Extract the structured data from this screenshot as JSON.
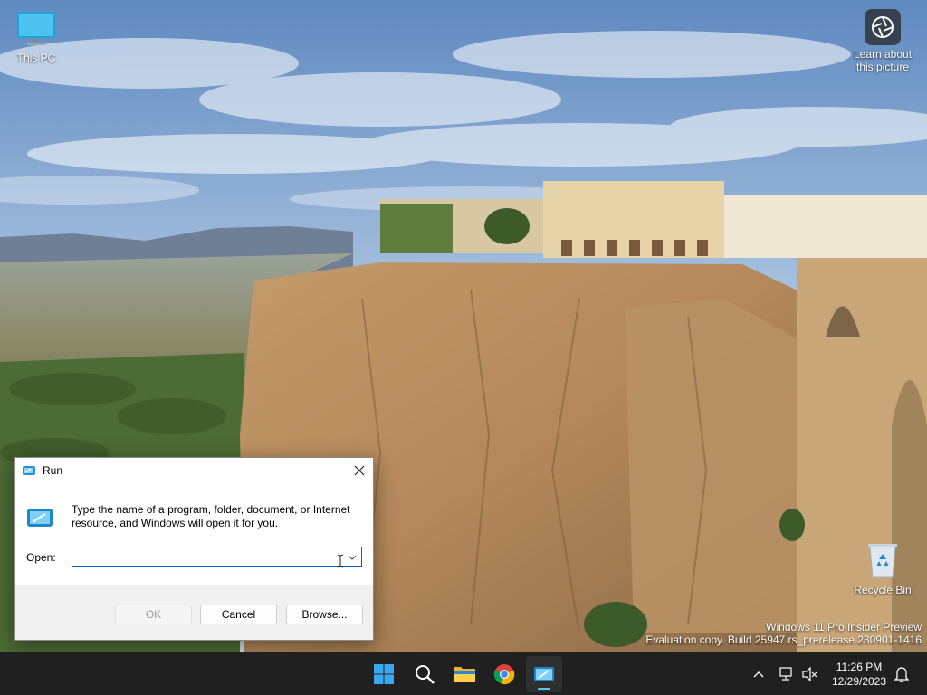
{
  "desktop": {
    "icons": [
      {
        "label": "This PC",
        "icon": "this-pc-icon"
      },
      {
        "label": "Recycle Bin",
        "icon": "recycle-bin-icon"
      }
    ],
    "spotlight": {
      "label": "Learn about this picture",
      "icon": "camera-lens-icon"
    },
    "watermark": {
      "line1": "Windows 11 Pro Insider Preview",
      "line2": "Evaluation copy. Build 25947.rs_prerelease.230901-1416"
    }
  },
  "run_dialog": {
    "title": "Run",
    "description": "Type the name of a program, folder, document, or Internet resource, and Windows will open it for you.",
    "open_label": "Open:",
    "open_value": "",
    "buttons": {
      "ok": "OK",
      "cancel": "Cancel",
      "browse": "Browse..."
    },
    "ok_enabled": false
  },
  "taskbar": {
    "apps": [
      {
        "name": "Start",
        "icon": "windows-logo-icon"
      },
      {
        "name": "Search",
        "icon": "search-icon"
      },
      {
        "name": "File Explorer",
        "icon": "folder-icon"
      },
      {
        "name": "Google Chrome",
        "icon": "chrome-icon"
      },
      {
        "name": "Run",
        "icon": "run-icon",
        "active": true
      }
    ],
    "time": "11:26 PM",
    "date": "12/29/2023"
  },
  "colors": {
    "accent": "#0067c0",
    "taskbar_bg": "#202020",
    "active_indicator": "#5cc6f2"
  }
}
